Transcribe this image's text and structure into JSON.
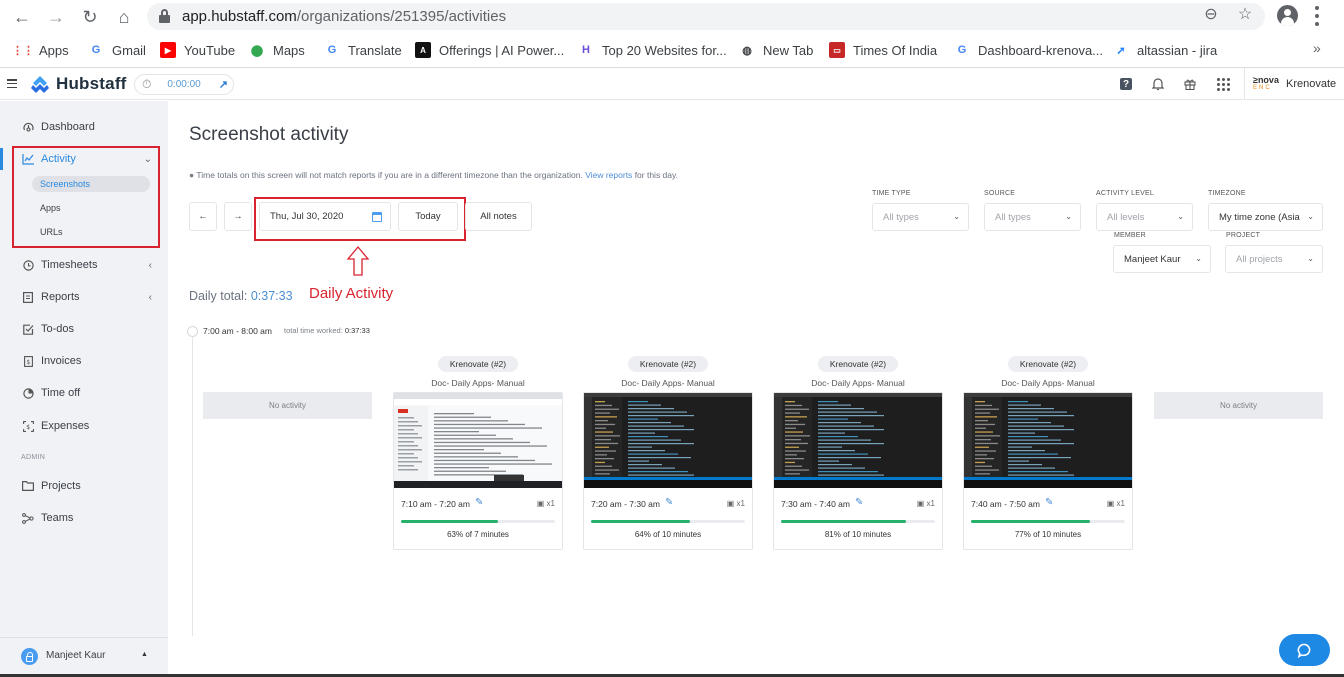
{
  "browser": {
    "url_host": "app.hubstaff.com",
    "url_path": "/organizations/251395/activities",
    "bookmarks": [
      {
        "label": "Apps",
        "icon": "apps-grid-icon",
        "color": "#e8453c"
      },
      {
        "label": "Gmail",
        "icon": "google-g-icon",
        "color": "#4285f4"
      },
      {
        "label": "YouTube",
        "icon": "youtube-icon",
        "color": "#ff0000"
      },
      {
        "label": "Maps",
        "icon": "maps-pin-icon",
        "color": "#34a853"
      },
      {
        "label": "Translate",
        "icon": "translate-icon",
        "color": "#4285f4"
      },
      {
        "label": "Offerings | AI Power...",
        "icon": "ai-logo-icon",
        "color": "#111111"
      },
      {
        "label": "Top 20 Websites for...",
        "icon": "h-logo-icon",
        "color": "#6b4fd8"
      },
      {
        "label": "New Tab",
        "icon": "globe-icon",
        "color": "#3c4043"
      },
      {
        "label": "Times Of India",
        "icon": "toi-icon",
        "color": "#c62828"
      },
      {
        "label": "Dashboard-krenova...",
        "icon": "google-g-icon",
        "color": "#4285f4"
      },
      {
        "label": "altassian - jira",
        "icon": "jira-icon",
        "color": "#2684ff"
      }
    ],
    "more_glyph": "»"
  },
  "header": {
    "brand": "Hubstaff",
    "timer": "0:00:00",
    "org_name": "Krenovate",
    "org_logo_top": "≥nova",
    "org_logo_bottom": "ENC"
  },
  "sidebar": {
    "items": [
      {
        "label": "Dashboard",
        "icon": "dashboard-gauge-icon"
      },
      {
        "label": "Activity",
        "icon": "activity-chart-icon",
        "active": true,
        "expanded": true
      },
      {
        "label": "Timesheets",
        "icon": "clock-icon",
        "has_children": true
      },
      {
        "label": "Reports",
        "icon": "report-doc-icon",
        "has_children": true
      },
      {
        "label": "To-dos",
        "icon": "checkbox-icon"
      },
      {
        "label": "Invoices",
        "icon": "invoice-icon"
      },
      {
        "label": "Time off",
        "icon": "pie-icon"
      },
      {
        "label": "Expenses",
        "icon": "expenses-icon"
      },
      {
        "label": "Projects",
        "icon": "folder-icon"
      },
      {
        "label": "Teams",
        "icon": "teams-icon"
      }
    ],
    "activity_sub": [
      "Screenshots",
      "Apps",
      "URLs"
    ],
    "selected_sub": "Screenshots",
    "section_admin": "ADMIN",
    "user_name": "Manjeet Kaur"
  },
  "main": {
    "title": "Screenshot activity",
    "tz_note": "Time totals on this screen will not match reports if you are in a different timezone than the organization.",
    "tz_link": "View reports",
    "tz_tail": "for this day.",
    "date": "Thu, Jul 30, 2020",
    "today_label": "Today",
    "all_notes_label": "All notes",
    "filters": {
      "time_type": {
        "label": "TIME TYPE",
        "value": "All types"
      },
      "source": {
        "label": "SOURCE",
        "value": "All types"
      },
      "activity_level": {
        "label": "ACTIVITY LEVEL",
        "value": "All levels"
      },
      "timezone": {
        "label": "TIMEZONE",
        "value": "My time zone (Asia"
      },
      "member": {
        "label": "MEMBER",
        "value": "Manjeet Kaur"
      },
      "project": {
        "label": "PROJECT",
        "value": "All projects"
      }
    },
    "daily_total_label": "Daily total:",
    "daily_total_value": "0:37:33",
    "annotation": "Daily Activity",
    "slot": {
      "range": "7:00 am - 8:00 am",
      "worked_label": "total time worked:",
      "worked_value": "0:37:33"
    },
    "no_activity": "No activity",
    "screenshots": [
      {
        "project": "Krenovate (#2)",
        "task": "Doc- Daily Apps- Manual",
        "range": "7:10 am - 7:20 am",
        "count": "x1",
        "activity_pct": 63,
        "summary": "63% of 7 minutes",
        "theme": "light"
      },
      {
        "project": "Krenovate (#2)",
        "task": "Doc- Daily Apps- Manual",
        "range": "7:20 am - 7:30 am",
        "count": "x1",
        "activity_pct": 64,
        "summary": "64% of 10 minutes",
        "theme": "dark"
      },
      {
        "project": "Krenovate (#2)",
        "task": "Doc- Daily Apps- Manual",
        "range": "7:30 am - 7:40 am",
        "count": "x1",
        "activity_pct": 81,
        "summary": "81% of 10 minutes",
        "theme": "dark"
      },
      {
        "project": "Krenovate (#2)",
        "task": "Doc- Daily Apps- Manual",
        "range": "7:40 am - 7:50 am",
        "count": "x1",
        "activity_pct": 77,
        "summary": "77% of 10 minutes",
        "theme": "dark"
      }
    ]
  },
  "colors": {
    "accent": "#2a8ae0",
    "progress": "#26b16b",
    "annotation": "#d9232e"
  }
}
